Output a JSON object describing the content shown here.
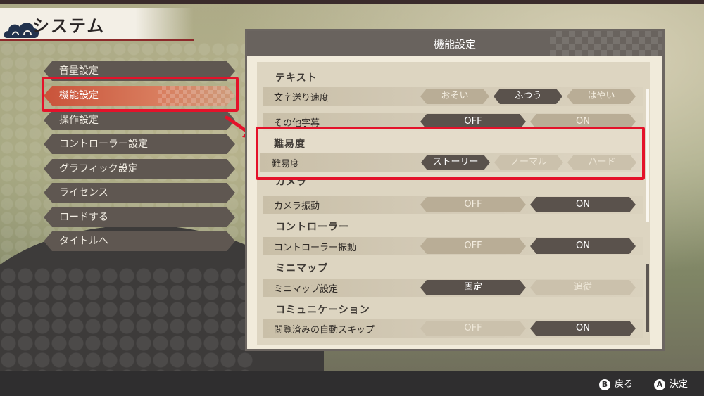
{
  "title": "システム",
  "menu": {
    "items": [
      {
        "label": "音量設定"
      },
      {
        "label": "機能設定"
      },
      {
        "label": "操作設定"
      },
      {
        "label": "コントローラー設定"
      },
      {
        "label": "グラフィック設定"
      },
      {
        "label": "ライセンス"
      },
      {
        "label": "ロードする"
      },
      {
        "label": "タイトルへ"
      }
    ],
    "active_index": 1
  },
  "panel": {
    "title": "機能設定",
    "sections": {
      "text": {
        "heading": "テキスト",
        "speed": {
          "label": "文字送り速度",
          "options": [
            "おそい",
            "ふつう",
            "はやい"
          ],
          "selected": "ふつう"
        },
        "subtitle": {
          "label": "その他字幕",
          "options": [
            "OFF",
            "ON"
          ],
          "selected": "OFF"
        }
      },
      "difficulty": {
        "heading": "難易度",
        "row": {
          "label": "難易度",
          "options": [
            "ストーリー",
            "ノーマル",
            "ハード"
          ],
          "selected": "ストーリー"
        }
      },
      "camera": {
        "heading": "カメラ",
        "row": {
          "label": "カメラ振動",
          "options": [
            "OFF",
            "ON"
          ],
          "selected": "ON"
        }
      },
      "controller": {
        "heading": "コントローラー",
        "row": {
          "label": "コントローラー振動",
          "options": [
            "OFF",
            "ON"
          ],
          "selected": "ON"
        }
      },
      "minimap": {
        "heading": "ミニマップ",
        "row": {
          "label": "ミニマップ設定",
          "options": [
            "固定",
            "追従"
          ],
          "selected": "固定"
        }
      },
      "communication": {
        "heading": "コミュニケーション",
        "row": {
          "label": "閲覧済みの自動スキップ",
          "options": [
            "OFF",
            "ON"
          ],
          "selected": "ON"
        }
      }
    }
  },
  "footer": {
    "back": {
      "button": "B",
      "label": "戻る"
    },
    "confirm": {
      "button": "A",
      "label": "決定"
    }
  },
  "colors": {
    "highlight": "#e4122a",
    "selected_option": "#5a524c",
    "menu_item": "#5f5751",
    "active_menu": "#c9533a"
  }
}
